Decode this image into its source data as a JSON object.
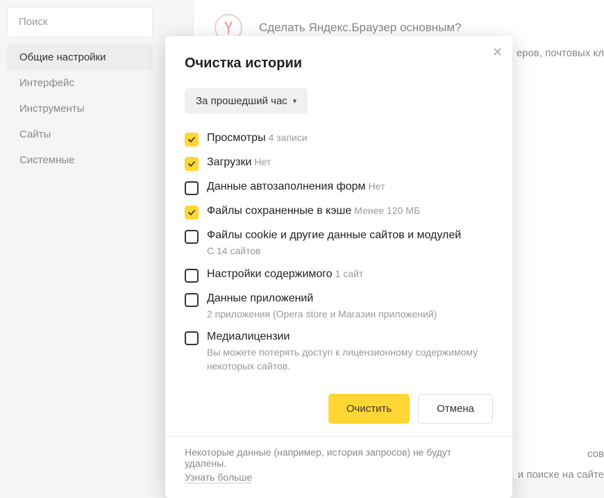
{
  "sidebar": {
    "search_placeholder": "Поиск",
    "items": [
      {
        "label": "Общие настройки",
        "active": true
      },
      {
        "label": "Интерфейс",
        "active": false
      },
      {
        "label": "Инструменты",
        "active": false
      },
      {
        "label": "Сайты",
        "active": false
      },
      {
        "label": "Системные",
        "active": false
      }
    ]
  },
  "background": {
    "banner_text": "Сделать Яндекс.Браузер основным?",
    "partial_right": "еров, почтовых кл",
    "partial_bottom1": "сов",
    "partial_bottom2": "и поиске на сайте"
  },
  "modal": {
    "title": "Очистка истории",
    "time_range": "За прошедший час",
    "options": [
      {
        "label": "Просмотры",
        "hint": "4 записи",
        "checked": true
      },
      {
        "label": "Загрузки",
        "hint": "Нет",
        "checked": true
      },
      {
        "label": "Данные автозаполнения форм",
        "hint": "Нет",
        "checked": false
      },
      {
        "label": "Файлы сохраненные в кэше",
        "hint": "Менее 120 МБ",
        "checked": true
      },
      {
        "label": "Файлы cookie и другие данные сайтов и модулей",
        "sub": "С 14 сайтов",
        "checked": false
      },
      {
        "label": "Настройки содержимого",
        "hint": "1 сайт",
        "checked": false
      },
      {
        "label": "Данные приложений",
        "sub": "2 приложения (Opera store и Магазин приложений)",
        "checked": false
      },
      {
        "label": "Медиалицензии",
        "sub": "Вы можете потерять доступ к лицензионному содержимому некоторых сайтов.",
        "checked": false
      }
    ],
    "clear_button": "Очистить",
    "cancel_button": "Отмена",
    "footer_text": "Некоторые данные (например, история запросов) не будут удалены.",
    "footer_link": "Узнать больше"
  }
}
